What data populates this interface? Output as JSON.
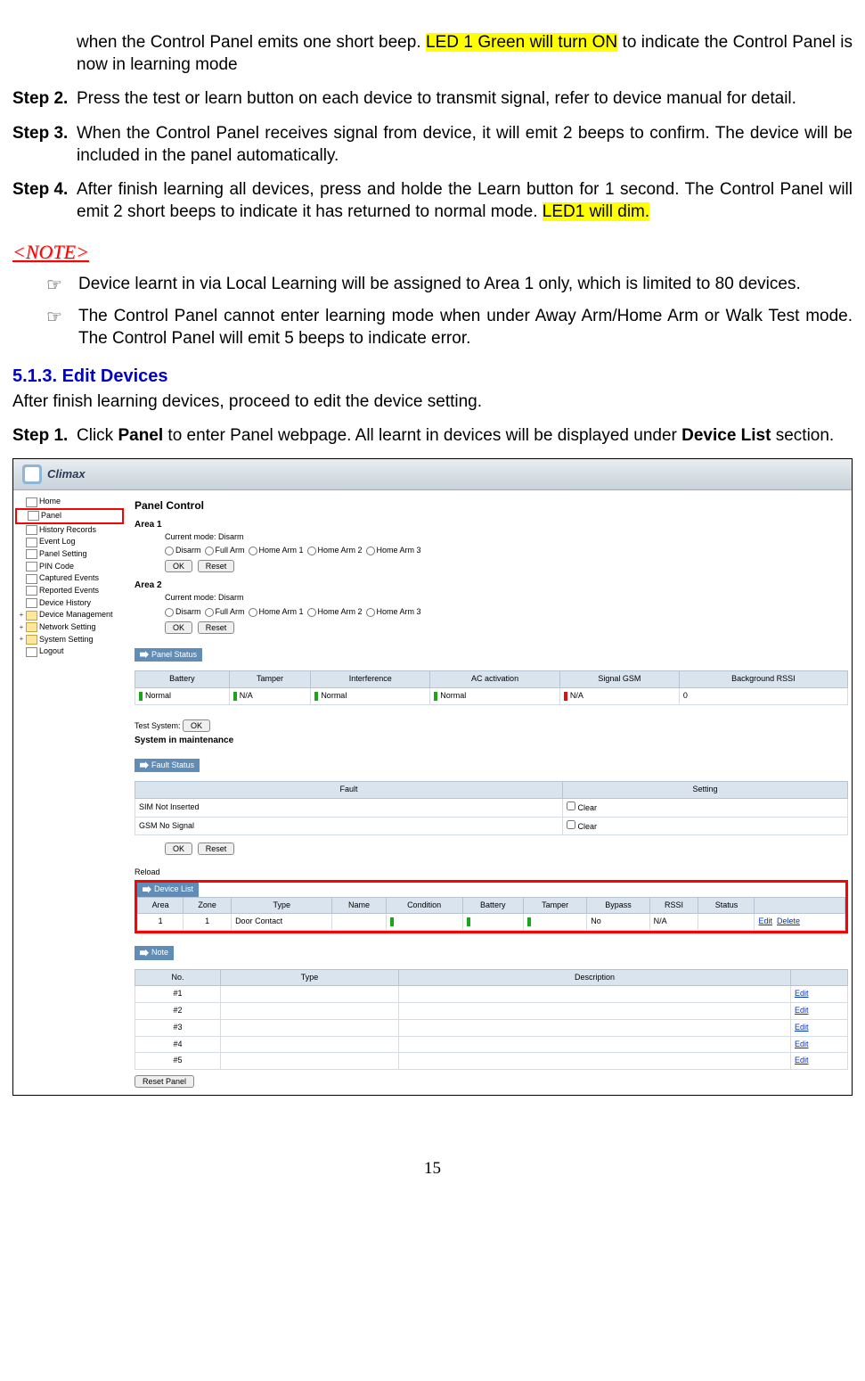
{
  "intro": {
    "line1a": "when the Control Panel emits one short beep. ",
    "hl1": "LED 1 Green will turn ON",
    "line1b": " to indicate the Control Panel is now in learning mode"
  },
  "steps": {
    "s2label": "Step 2.",
    "s2text": "Press the test or learn button on each device to transmit signal, refer to device manual for detail.",
    "s3label": "Step 3.",
    "s3text": "When the Control Panel receives signal from device, it will emit 2 beeps to confirm. The device will be included in the panel automatically.",
    "s4label": "Step 4.",
    "s4a": "After finish learning all devices, press and holde the Learn button for 1 second. The Control Panel will emit 2 short beeps to indicate it has returned to normal mode. ",
    "s4hl": "LED1 will dim."
  },
  "note_header": "<NOTE>",
  "notes": {
    "n1": "Device learnt in via Local Learning will be assigned to Area 1 only, which is limited to 80 devices.",
    "n2": "The Control Panel cannot enter learning mode when under Away Arm/Home Arm or Walk Test mode. The Control Panel will emit 5 beeps to indicate error."
  },
  "section": {
    "title": "5.1.3. Edit Devices",
    "sub": "After finish learning devices, proceed to edit the device setting.",
    "s1label": "Step 1.",
    "s1a": "Click ",
    "s1b": "Panel",
    "s1c": " to enter Panel webpage. All learnt in devices will be displayed under ",
    "s1d": "Device List",
    "s1e": " section."
  },
  "ui": {
    "brand": "Climax",
    "side": {
      "i0": "Home",
      "i1": "Panel",
      "i2": "History Records",
      "i3": "Event Log",
      "i4": "Panel Setting",
      "i5": "PIN Code",
      "i6": "Captured Events",
      "i7": "Reported Events",
      "i8": "Device History",
      "i9": "Device Management",
      "i10": "Network Setting",
      "i11": "System Setting",
      "i12": "Logout"
    },
    "panel_title": "Panel Control",
    "area1": "Area 1",
    "area2": "Area 2",
    "cur_mode": "Current mode:  Disarm",
    "opts": {
      "disarm": "Disarm",
      "full": "Full Arm",
      "h1": "Home Arm 1",
      "h2": "Home Arm 2",
      "h3": "Home Arm 3"
    },
    "btn_ok": "OK",
    "btn_reset": "Reset",
    "ps_title": "Panel Status",
    "ps_hdr": {
      "bat": "Battery",
      "tamp": "Tamper",
      "intf": "Interference",
      "ac": "AC activation",
      "gsm": "Signal GSM",
      "rssi": "Background RSSI"
    },
    "ps_row": {
      "bat": "Normal",
      "tamp": "N/A",
      "intf": "Normal",
      "ac": "Normal",
      "gsm": "N/A",
      "rssi": "0"
    },
    "test_label": "Test System:",
    "maint": "System in maintenance",
    "fs_title": "Fault Status",
    "fs_hdr": {
      "fault": "Fault",
      "setting": "Setting"
    },
    "fs_rows": {
      "r1": "SIM Not Inserted",
      "r2": "GSM No Signal",
      "clear": "Clear"
    },
    "reload": "Reload",
    "dl_title": "Device List",
    "dl_hdr": {
      "area": "Area",
      "zone": "Zone",
      "type": "Type",
      "name": "Name",
      "cond": "Condition",
      "bat": "Battery",
      "tamp": "Tamper",
      "bypass": "Bypass",
      "rssi": "RSSI",
      "status": "Status"
    },
    "dl_row": {
      "area": "1",
      "zone": "1",
      "type": "Door Contact",
      "bypass": "No",
      "rssi": "N/A",
      "edit": "Edit",
      "del": "Delete"
    },
    "note_title": "Note",
    "note_hdr": {
      "no": "No.",
      "type": "Type",
      "desc": "Description"
    },
    "note_rows": {
      "r1": "#1",
      "r2": "#2",
      "r3": "#3",
      "r4": "#4",
      "r5": "#5",
      "edit": "Edit"
    },
    "reset_panel": "Reset Panel"
  },
  "page_num": "15"
}
